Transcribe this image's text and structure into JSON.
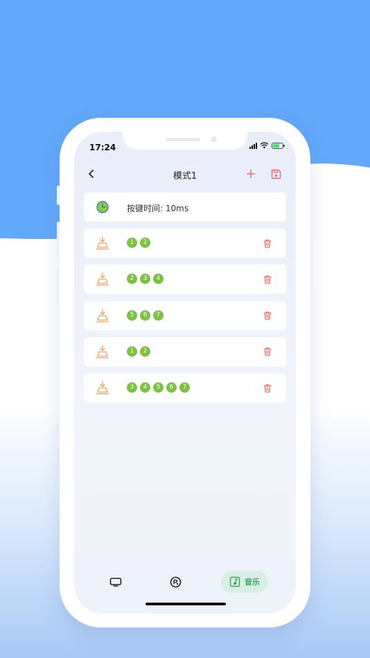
{
  "status": {
    "time": "17:24"
  },
  "header": {
    "title": "模式1"
  },
  "timer": {
    "label": "按键时间: 10ms"
  },
  "steps": [
    {
      "keys": [
        "1",
        "2"
      ]
    },
    {
      "keys": [
        "2",
        "3",
        "4"
      ]
    },
    {
      "keys": [
        "5",
        "6",
        "7"
      ]
    },
    {
      "keys": [
        "1",
        "2"
      ]
    },
    {
      "keys": [
        "3",
        "4",
        "5",
        "6",
        "7"
      ]
    }
  ],
  "tabbar": {
    "active_label": "音乐"
  },
  "colors": {
    "background_blue": "#62a8fb",
    "accent_red": "#f06b6b",
    "badge_green": "#7ec245",
    "tab_active_bg": "#d9efe3",
    "tab_active_text": "#3aa566",
    "step_icon_orange": "#f0a15a"
  },
  "icons": {
    "back": "chevron-left-icon",
    "add": "plus-icon",
    "save": "save-icon",
    "timer": "clock-icon",
    "step": "key-press-icon",
    "delete": "trash-icon",
    "tab1": "tv-icon",
    "tab2": "gamepad-icon",
    "tab3": "music-icon"
  }
}
